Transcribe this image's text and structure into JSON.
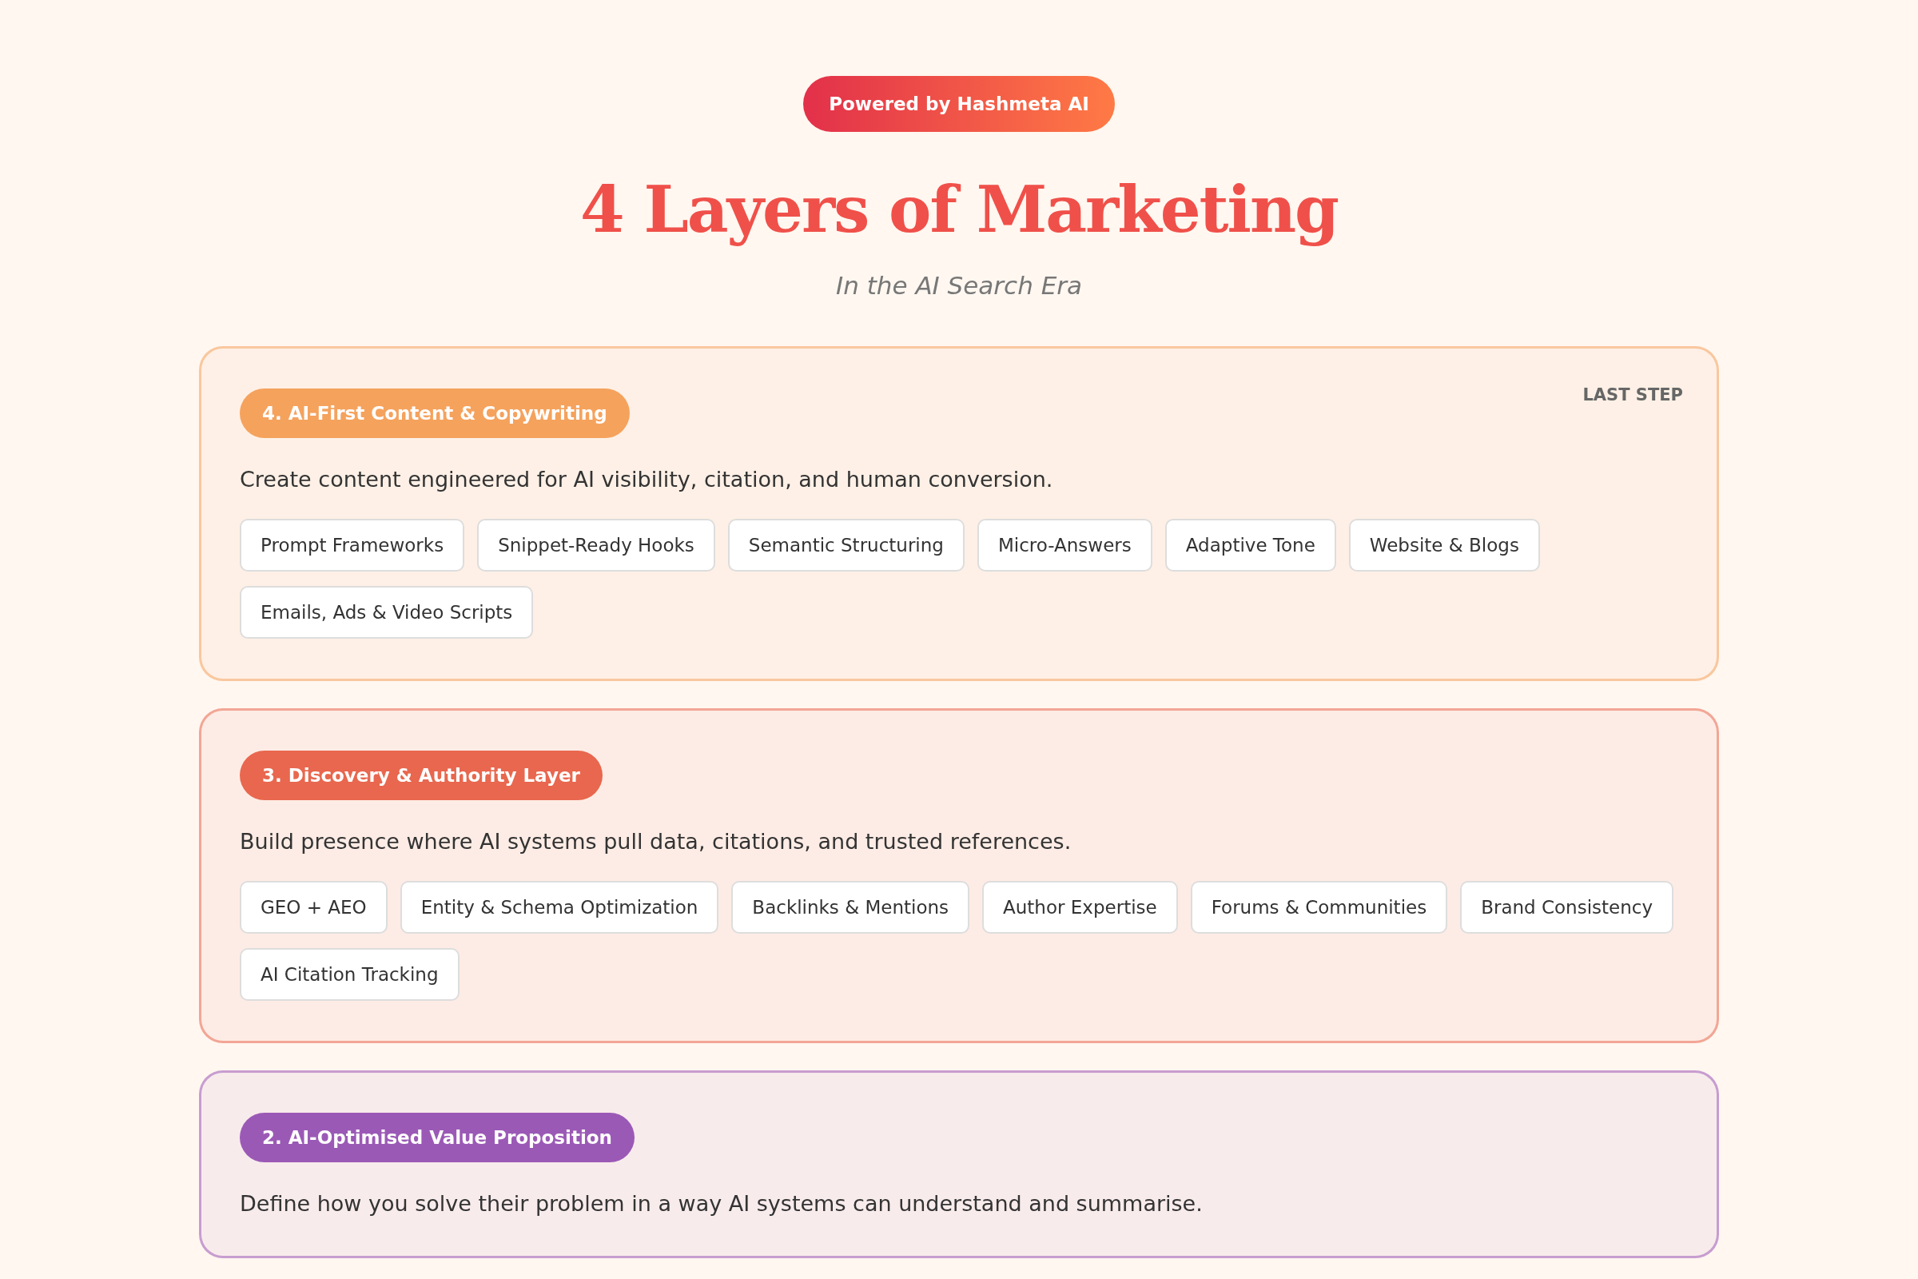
{
  "badge": "Powered by Hashmeta AI",
  "title": "4 Layers of Marketing",
  "subtitle": "In the AI Search Era",
  "layers": [
    {
      "label": "4. AI-First Content & Copywriting",
      "color": "#f5a25d",
      "tag": "LAST STEP",
      "description": "Create content engineered for AI visibility, citation, and human conversion.",
      "chips": [
        "Prompt Frameworks",
        "Snippet-Ready Hooks",
        "Semantic Structuring",
        "Micro-Answers",
        "Adaptive Tone",
        "Website & Blogs",
        "Emails, Ads & Video Scripts"
      ]
    },
    {
      "label": "3. Discovery & Authority Layer",
      "color": "#e8674e",
      "description": "Build presence where AI systems pull data, citations, and trusted references.",
      "chips": [
        "GEO + AEO",
        "Entity & Schema Optimization",
        "Backlinks & Mentions",
        "Author Expertise",
        "Forums & Communities",
        "Brand Consistency",
        "AI Citation Tracking"
      ]
    },
    {
      "label": "2. AI-Optimised Value Proposition",
      "color": "#9b59b6",
      "description": "Define how you solve their problem in a way AI systems can understand and summarise."
    }
  ]
}
